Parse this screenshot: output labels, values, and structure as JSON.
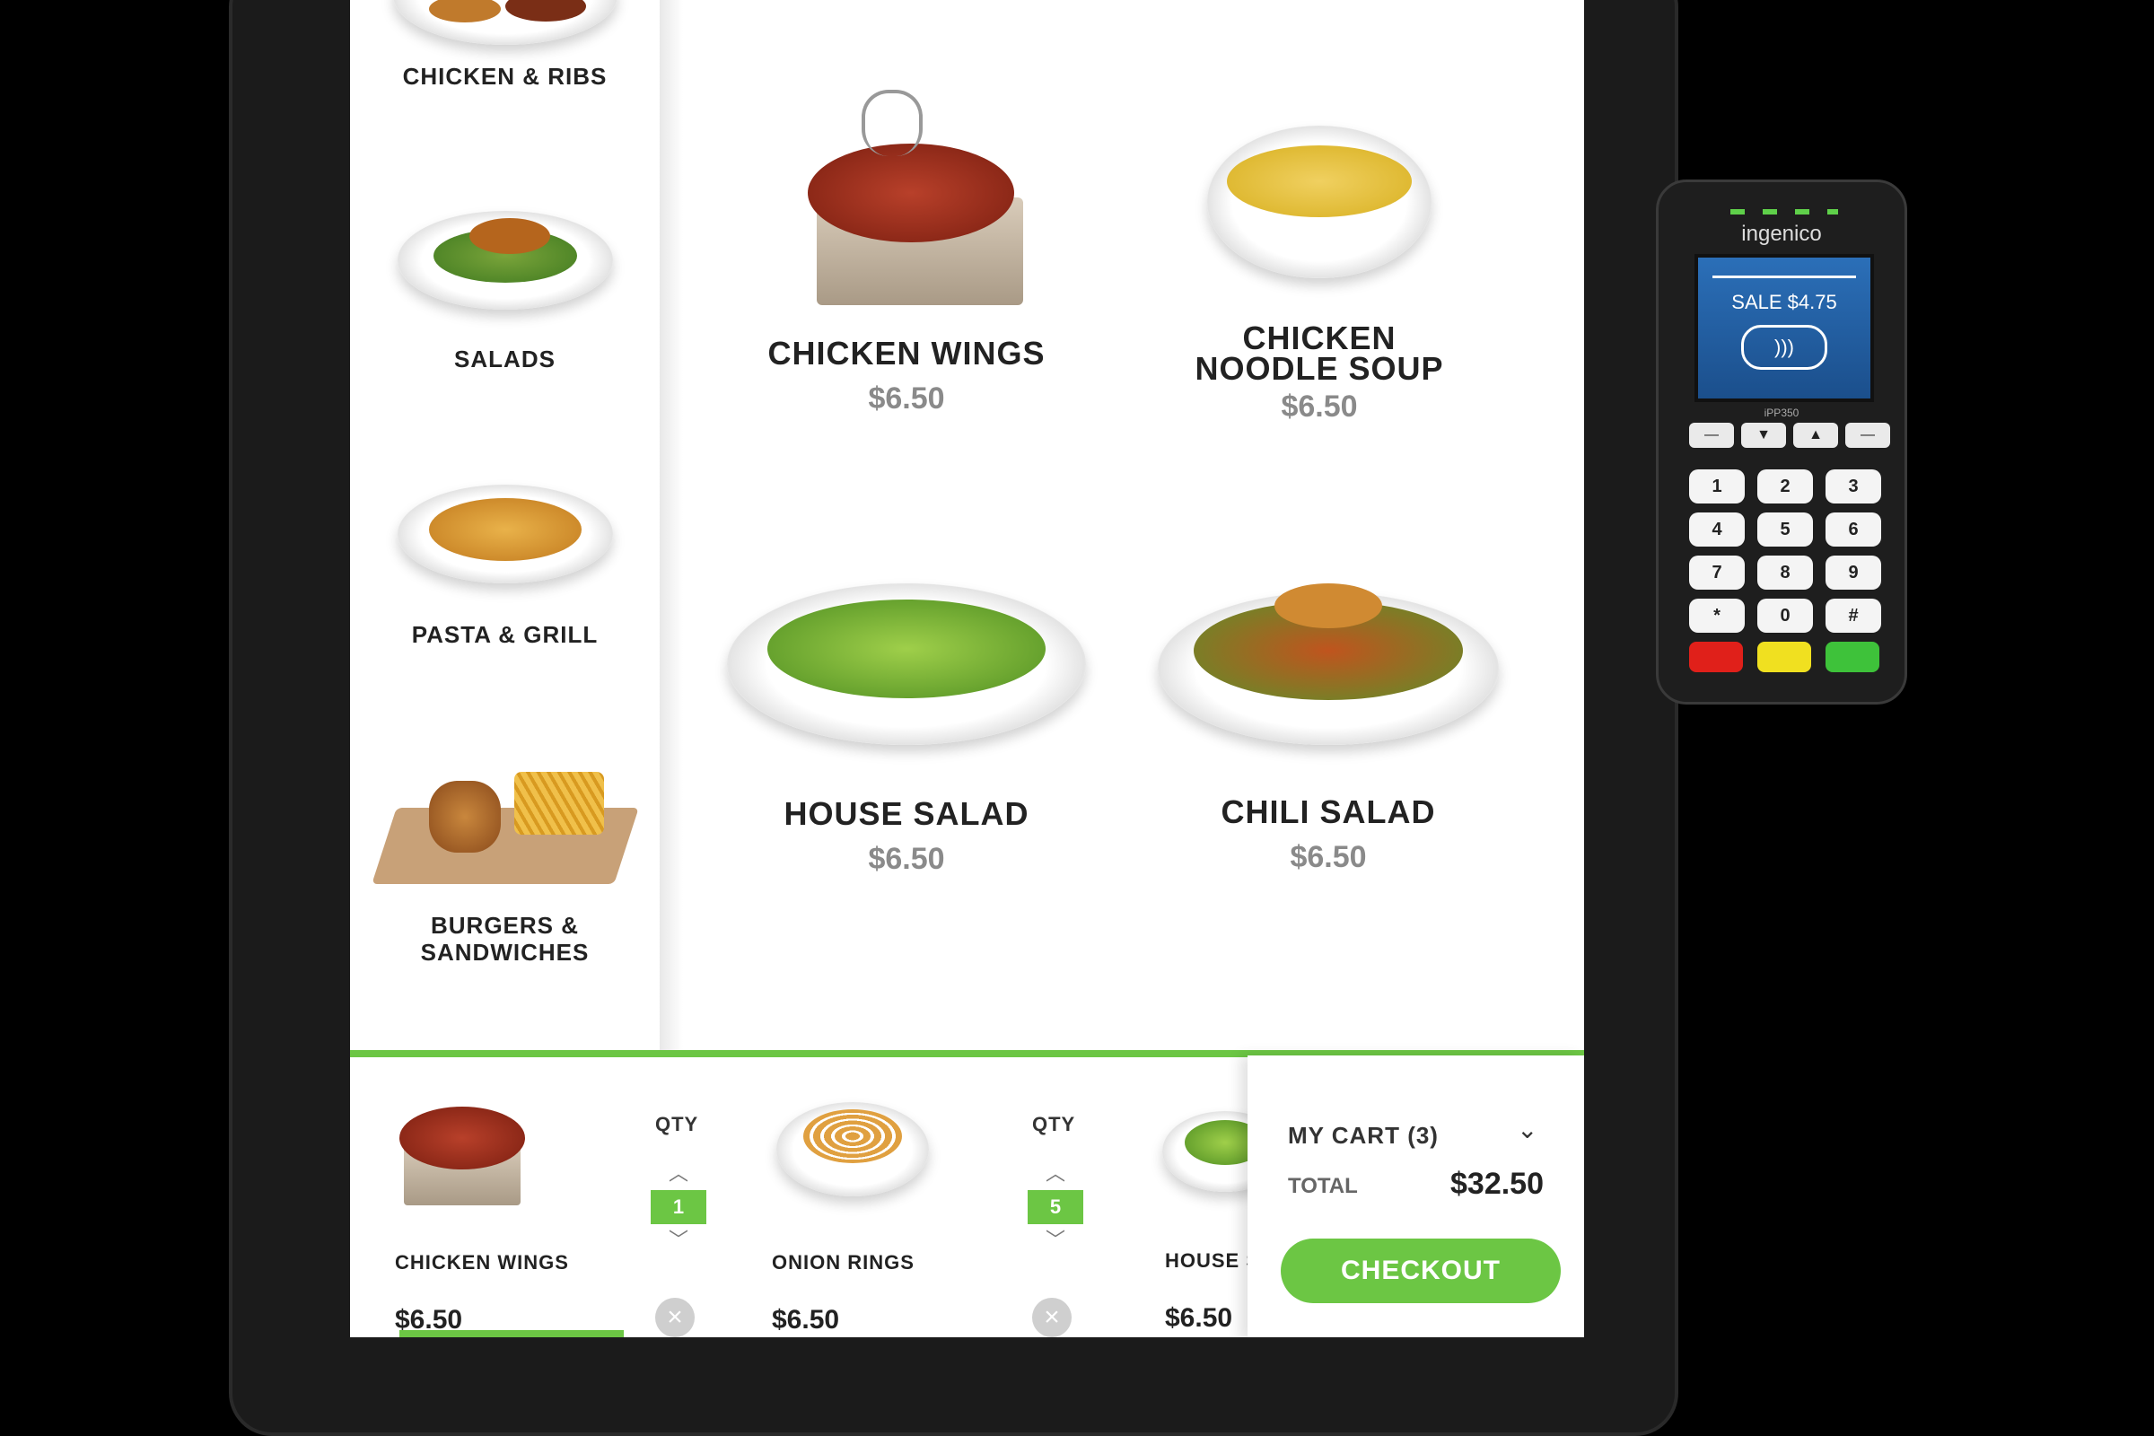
{
  "categories": [
    {
      "label": "CHICKEN & RIBS"
    },
    {
      "label": "SALADS"
    },
    {
      "label": "PASTA & GRILL"
    },
    {
      "label_line1": "BURGERS &",
      "label_line2": "SANDWICHES"
    }
  ],
  "menu_items": [
    {
      "name": "CHICKEN WINGS",
      "price": "$6.50"
    },
    {
      "name_line1": "CHICKEN",
      "name_line2": "NOODLE SOUP",
      "price": "$6.50"
    },
    {
      "name": "HOUSE SALAD",
      "price": "$6.50"
    },
    {
      "name": "CHILI SALAD",
      "price": "$6.50"
    }
  ],
  "cart_items": [
    {
      "name": "CHICKEN WINGS",
      "price": "$6.50",
      "qty_label": "QTY",
      "qty": "1"
    },
    {
      "name": "ONION RINGS",
      "price": "$6.50",
      "qty_label": "QTY",
      "qty": "5"
    },
    {
      "name": "HOUSE S",
      "price": "$6.50"
    }
  ],
  "cart_summary": {
    "title": "MY CART (3)",
    "total_label": "TOTAL",
    "total": "$32.50",
    "checkout_label": "CHECKOUT"
  },
  "terminal": {
    "brand": "ingenico",
    "screen_sale": "SALE",
    "screen_amount": "$4.75",
    "model": "iPP350",
    "keys": [
      "1",
      "2",
      "3",
      "4",
      "5",
      "6",
      "7",
      "8",
      "9",
      "*",
      "0",
      "#"
    ]
  },
  "colors": {
    "accent_green": "#6cc644",
    "price_gray": "#8a8a8a"
  },
  "icons": {
    "collapse": "chevron-down-icon",
    "remove": "close-icon",
    "contactless": "contactless-icon"
  }
}
